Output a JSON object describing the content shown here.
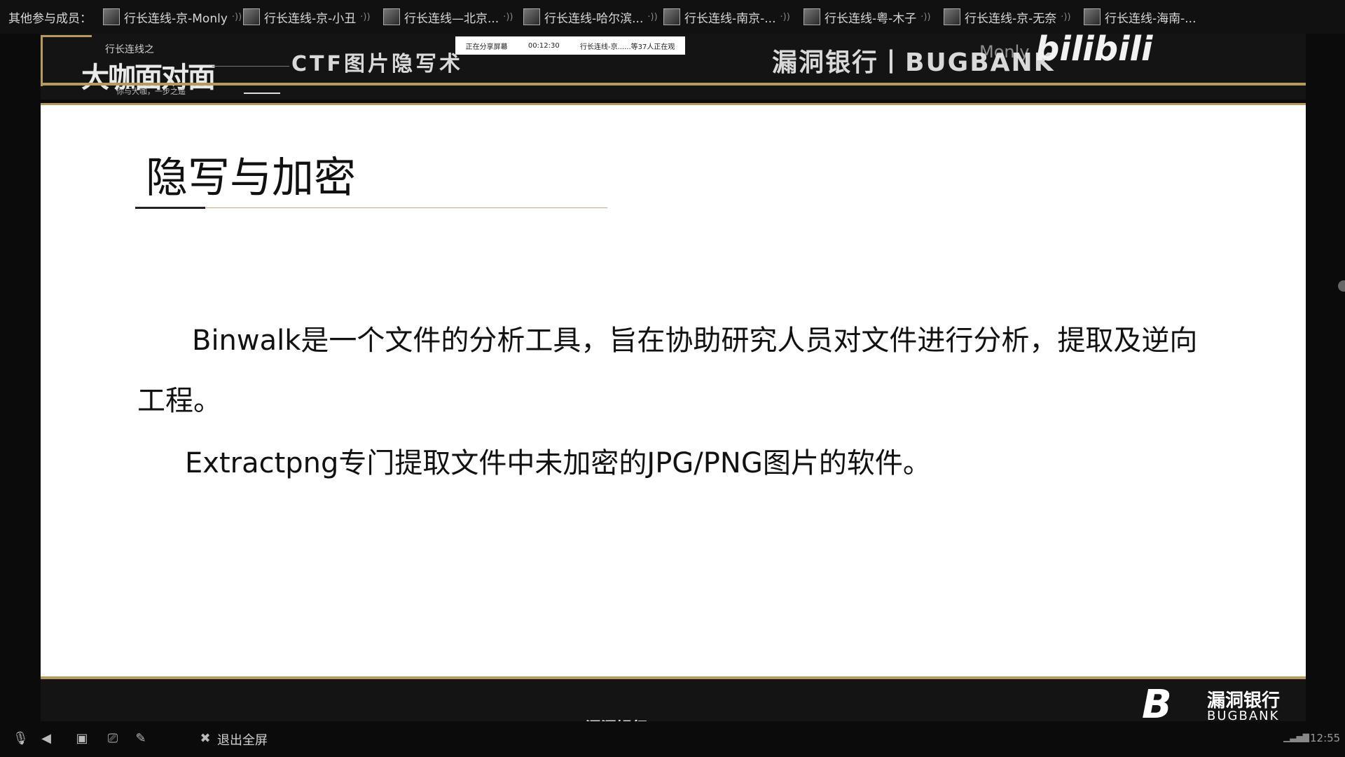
{
  "participants": {
    "label": "其他参与成员：",
    "items": [
      {
        "name": "行长连线-京-Monly"
      },
      {
        "name": "行长连线-京-小丑"
      },
      {
        "name": "行长连线—北京..."
      },
      {
        "name": "行长连线-哈尔滨..."
      },
      {
        "name": "行长连线-南京-..."
      },
      {
        "name": "行长连线-粤-木子"
      },
      {
        "name": "行长连线-京-无奈"
      },
      {
        "name": "行长连线-海南-..."
      }
    ]
  },
  "header": {
    "logo_top": "行长连线之",
    "logo_big": "大咖面对面",
    "logo_sub": "你与大咖，一步之遥",
    "course_title": "CTF图片隐写术",
    "brand": "漏洞银行丨BUGBANK",
    "user_overlay": "Monly",
    "platform_logo": "bilibili",
    "share_bar": {
      "status": "正在分享屏幕",
      "timer": "00:12:30",
      "viewers": "行长连线-京......等37人正在观"
    }
  },
  "slide": {
    "title": "隐写与加密",
    "paragraph1": "Binwalk是一个文件的分析工具，旨在协助研究人员对文件进行分析，提取及逆向工程。",
    "paragraph2": "Extractpng专门提取文件中未加密的JPG/PNG图片的软件。"
  },
  "footer": {
    "center_brand": "漏洞银行 | BUGBANK",
    "logo_mark": "B",
    "brand_cn": "漏洞银行",
    "brand_en": "BUGBANK"
  },
  "controls": {
    "exit_fullscreen": "退出全屏",
    "time": "12:55",
    "icons": [
      "mic-muted-icon",
      "speaker-icon",
      "camera-off-icon",
      "screen-share-icon",
      "edit-icon",
      "exit-fullscreen-icon"
    ]
  }
}
